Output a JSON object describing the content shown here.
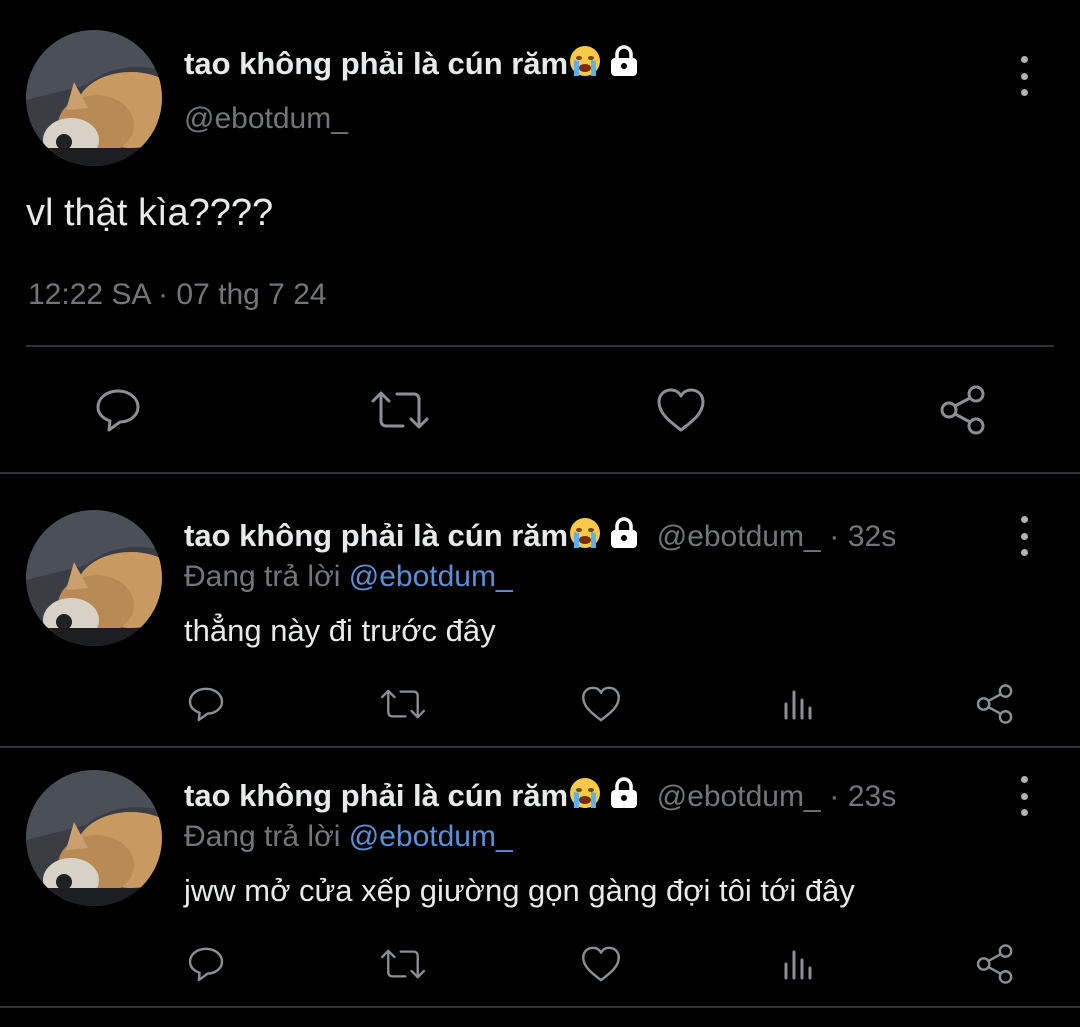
{
  "main_tweet": {
    "display_name": "tao không phải là cún răm",
    "emoji_icon": "crying-face-emoji",
    "lock_icon": "lock-icon",
    "handle": "@ebotdum_",
    "text": "vl thật kìa????",
    "timestamp": "12:22 SA · 07 thg 7 24",
    "actions": [
      "reply-icon",
      "retweet-icon",
      "like-icon",
      "share-icon"
    ]
  },
  "replies": [
    {
      "display_name": "tao không phải là cún răm",
      "handle": "@ebotdum_",
      "time": "32s",
      "replying_prefix": "Đang trả lời",
      "replying_to": "@ebotdum_",
      "text": "thẳng này đi trước đây"
    },
    {
      "display_name": "tao không phải là cún răm",
      "handle": "@ebotdum_",
      "time": "23s",
      "replying_prefix": "Đang trả lời",
      "replying_to": "@ebotdum_",
      "text": "jww mở cửa xếp giường gọn gàng đợi tôi tới đây"
    }
  ],
  "separator": "·",
  "colors": {
    "background": "#000000",
    "text": "#e7e9ea",
    "muted": "#71767b",
    "link": "#5b8fd6",
    "divider": "#2f3336",
    "icon": "#8b9096"
  }
}
